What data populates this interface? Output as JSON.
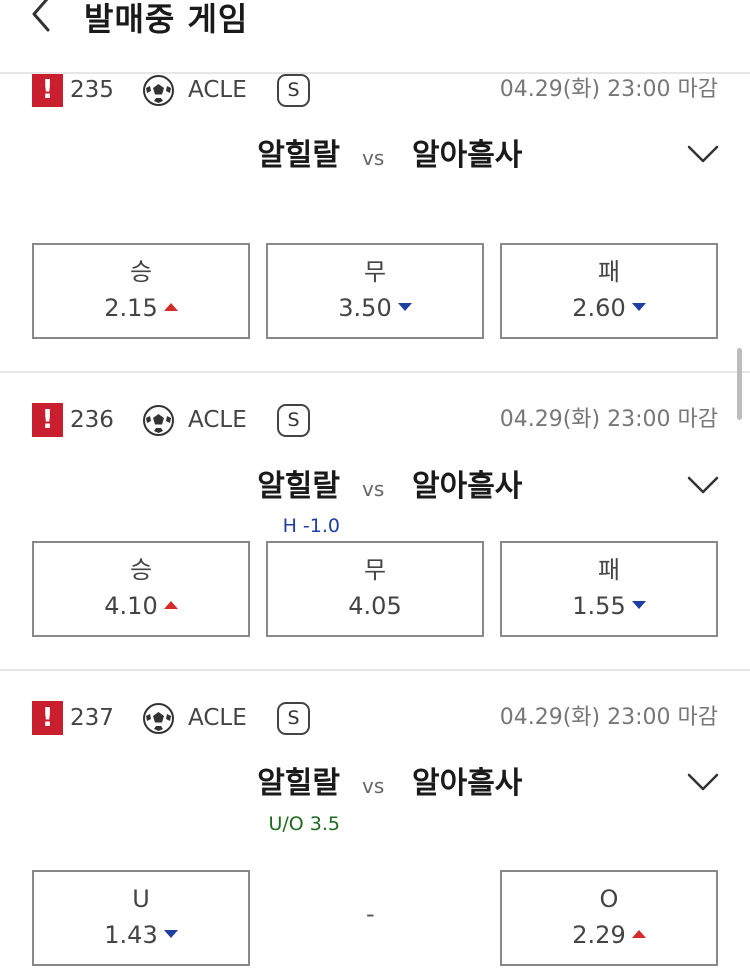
{
  "header": {
    "title": "발매중 게임"
  },
  "games": [
    {
      "number": "235",
      "league": "ACLE",
      "badge": "S",
      "deadline": "04.29(화) 23:00 마감",
      "home": "알힐랄",
      "vs": "vs",
      "away": "알아흘사",
      "handicap": "",
      "odds": [
        {
          "label": "승",
          "value": "2.15",
          "trend": "up"
        },
        {
          "label": "무",
          "value": "3.50",
          "trend": "down"
        },
        {
          "label": "패",
          "value": "2.60",
          "trend": "down"
        }
      ]
    },
    {
      "number": "236",
      "league": "ACLE",
      "badge": "S",
      "deadline": "04.29(화) 23:00 마감",
      "home": "알힐랄",
      "vs": "vs",
      "away": "알아흘사",
      "handicap": "H -1.0",
      "odds": [
        {
          "label": "승",
          "value": "4.10",
          "trend": "up"
        },
        {
          "label": "무",
          "value": "4.05",
          "trend": "none"
        },
        {
          "label": "패",
          "value": "1.55",
          "trend": "down"
        }
      ]
    },
    {
      "number": "237",
      "league": "ACLE",
      "badge": "S",
      "deadline": "04.29(화) 23:00 마감",
      "home": "알힐랄",
      "vs": "vs",
      "away": "알아흘사",
      "handicap": "U/O 3.5",
      "middle": "-",
      "odds": [
        {
          "label": "U",
          "value": "1.43",
          "trend": "down"
        },
        {
          "label": "O",
          "value": "2.29",
          "trend": "up"
        }
      ]
    }
  ],
  "colors": {
    "warn": "#c81e2d",
    "up": "#d42b2b",
    "down": "#1f3fa3",
    "handicap_h": "#1f3fa3",
    "handicap_uo": "#1e6b1e"
  },
  "icons": {
    "back": "chevron-left-icon",
    "warning": "exclamation-icon",
    "sport": "soccer-ball-icon",
    "expand": "chevron-down-icon"
  }
}
